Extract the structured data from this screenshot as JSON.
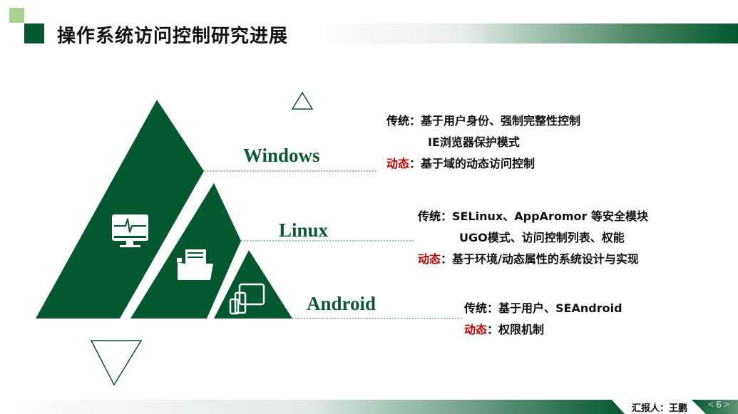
{
  "title": "操作系统访问控制研究进展",
  "colors": {
    "brand_green": "#03582f",
    "light_green": "#a9d18e",
    "dynamic_red": "#c00000"
  },
  "layers": [
    {
      "name": "Windows",
      "icon": "monitor-heartbeat-icon",
      "lines": [
        {
          "tag": "传统",
          "sep": "：",
          "text": "基于用户身份、强制完整性控制"
        },
        {
          "tag": "",
          "sep": "",
          "text": "IE浏览器保护模式"
        },
        {
          "tag": "动态",
          "sep": "：",
          "text": "基于域的动态访问控制",
          "dynamic": true
        }
      ]
    },
    {
      "name": "Linux",
      "icon": "folder-document-icon",
      "lines": [
        {
          "tag": "传统",
          "sep": "：",
          "text": "SELinux、AppAromor 等安全模块"
        },
        {
          "tag": "",
          "sep": "",
          "text": "UGO模式、访问控制列表、权能"
        },
        {
          "tag": "动态",
          "sep": "：",
          "text": "基于环境/动态属性的系统设计与实现",
          "dynamic": true
        }
      ]
    },
    {
      "name": "Android",
      "icon": "multi-device-icon",
      "lines": [
        {
          "tag": "传统",
          "sep": "：",
          "text": "基于用户、SEAndroid"
        },
        {
          "tag": "动态",
          "sep": "：",
          "text": "权限机制",
          "dynamic": true
        }
      ]
    }
  ],
  "footer": {
    "reporter": "汇报人：王鹏",
    "page": "< 6 >"
  }
}
